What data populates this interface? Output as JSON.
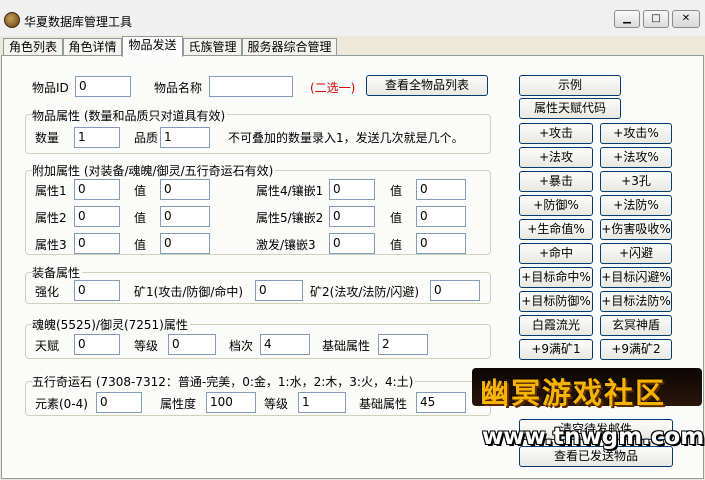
{
  "window": {
    "title": "华夏数据库管理工具",
    "minimize_glyph": "▁",
    "maximize_glyph": "□",
    "close_glyph": "✕"
  },
  "tabs": [
    {
      "label": "角色列表"
    },
    {
      "label": "角色详情"
    },
    {
      "label": "物品发送",
      "active": true
    },
    {
      "label": "氏族管理"
    },
    {
      "label": "服务器综合管理"
    }
  ],
  "item_select": {
    "item_id_label": "物品ID",
    "item_id_value": "0",
    "item_name_label": "物品名称",
    "item_name_value": "",
    "either_one_hint": "(二选一)",
    "view_all_button": "查看全物品列表"
  },
  "item_props": {
    "title": "物品属性 (数量和品质只对道具有效)",
    "quantity_label": "数量",
    "quantity_value": "1",
    "quality_label": "品质",
    "quality_value": "1",
    "note": "不可叠加的数量录入1，发送几次就是几个。"
  },
  "extra_props": {
    "title": "附加属性 (对装备/魂魄/御灵/五行奇运石有效)",
    "value_label": "值",
    "rows": [
      {
        "left_label": "属性1",
        "left_value": "0",
        "left_val": "0",
        "right_label": "属性4/镶嵌1",
        "right_value": "0",
        "right_val": "0"
      },
      {
        "left_label": "属性2",
        "left_value": "0",
        "left_val": "0",
        "right_label": "属性5/镶嵌2",
        "right_value": "0",
        "right_val": "0"
      },
      {
        "left_label": "属性3",
        "left_value": "0",
        "left_val": "0",
        "right_label": "激发/镶嵌3",
        "right_value": "0",
        "right_val": "0"
      }
    ]
  },
  "equip_props": {
    "title": "装备属性",
    "enhance_label": "强化",
    "enhance_value": "0",
    "mine1_label": "矿1(攻击/防御/命中)",
    "mine1_value": "0",
    "mine2_label": "矿2(法攻/法防/闪避)",
    "mine2_value": "0"
  },
  "soul_props": {
    "title": "魂魄(5525)/御灵(7251)属性",
    "talent_label": "天赋",
    "talent_value": "0",
    "level_label": "等级",
    "level_value": "0",
    "tier_label": "档次",
    "tier_value": "4",
    "base_label": "基础属性",
    "base_value": "2"
  },
  "stone_props": {
    "title": "五行奇运石 (7308-7312：普通-完美，0:金，1:水，2:木，3:火，4:土)",
    "element_label": "元素(0-4)",
    "element_value": "0",
    "attr_label": "属性度",
    "attr_value": "100",
    "level_label": "等级",
    "level_value": "1",
    "base_label": "基础属性",
    "base_value": "45"
  },
  "right_panel": {
    "example_button": "示例",
    "talent_code_button": "属性天赋代码",
    "grid": [
      [
        "+攻击",
        "+攻击%"
      ],
      [
        "+法攻",
        "+法攻%"
      ],
      [
        "+暴击",
        "+3孔"
      ],
      [
        "+防御%",
        "+法防%"
      ],
      [
        "+生命值%",
        "+伤害吸收%"
      ],
      [
        "+命中",
        "+闪避"
      ],
      [
        "+目标命中%",
        "+目标闪避%"
      ],
      [
        "+目标防御%",
        "+目标法防%"
      ],
      [
        "白霞流光",
        "玄冥神盾"
      ],
      [
        "+9满矿1",
        "+9满矿2"
      ]
    ],
    "clear_button": "清空待发邮件",
    "sent_button": "查看已发送物品"
  },
  "watermark": {
    "text": "幽冥游戏社区",
    "url": "www.tnwgm.com"
  }
}
